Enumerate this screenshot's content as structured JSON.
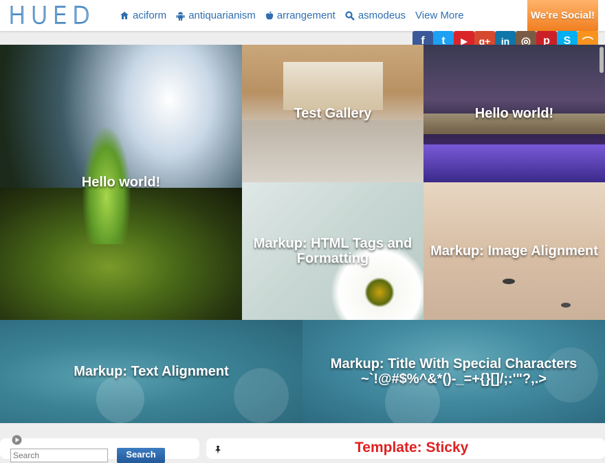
{
  "header": {
    "logo": "HUED",
    "nav": [
      {
        "label": "aciform",
        "icon": "home-icon"
      },
      {
        "label": "antiquarianism",
        "icon": "android-icon"
      },
      {
        "label": "arrangement",
        "icon": "apple-icon"
      },
      {
        "label": "asmodeus",
        "icon": "search-icon"
      },
      {
        "label": "View More",
        "icon": ""
      }
    ],
    "social_label": "We're Social!"
  },
  "social_icons": [
    {
      "name": "facebook-icon",
      "glyph": "f",
      "color": "#3b5998"
    },
    {
      "name": "twitter-icon",
      "glyph": "t",
      "color": "#1da1f2"
    },
    {
      "name": "youtube-icon",
      "glyph": "▶",
      "color": "#d9252a"
    },
    {
      "name": "google-plus-icon",
      "glyph": "g+",
      "color": "#d6492f"
    },
    {
      "name": "linkedin-icon",
      "glyph": "in",
      "color": "#0e76a8"
    },
    {
      "name": "instagram-icon",
      "glyph": "◎",
      "color": "#7a5c45"
    },
    {
      "name": "pinterest-icon",
      "glyph": "p",
      "color": "#cb2027"
    },
    {
      "name": "skype-icon",
      "glyph": "S",
      "color": "#00aff0"
    },
    {
      "name": "rss-icon",
      "glyph": "⌒",
      "color": "#f7931e"
    }
  ],
  "tiles": [
    {
      "name": "tile-hello-world-plant",
      "title": "Hello world!"
    },
    {
      "name": "tile-test-gallery",
      "title": "Test Gallery"
    },
    {
      "name": "tile-hello-world-bridge",
      "title": "Hello world!"
    },
    {
      "name": "tile-markup-html-tags",
      "title": "Markup: HTML Tags and Formatting"
    },
    {
      "name": "tile-markup-image-alignment",
      "title": "Markup: Image Alignment"
    },
    {
      "name": "tile-markup-text-alignment",
      "title": "Markup: Text Alignment"
    },
    {
      "name": "tile-markup-special-characters",
      "title": "Markup: Title With Special Characters ~`!@#$%^&*()-_=+{}[]/;:'\"?,.>"
    }
  ],
  "sidebar": {
    "search_placeholder": "Search",
    "search_button": "Search"
  },
  "main": {
    "sticky_title": "Template: Sticky"
  }
}
